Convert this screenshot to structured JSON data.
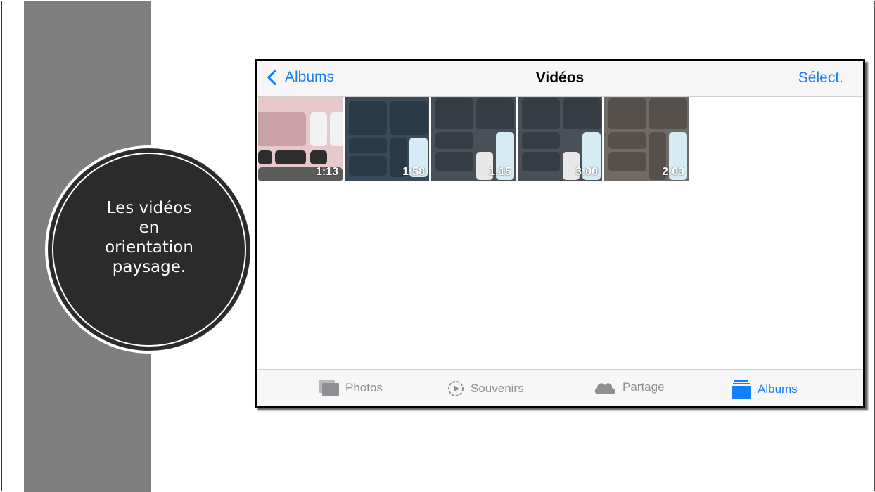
{
  "slide": {
    "caption_lines": [
      "Les vidéos",
      "en",
      "orientation",
      "paysage."
    ]
  },
  "navbar": {
    "back_label": "Albums",
    "title": "Vidéos",
    "select_label": "Sélect."
  },
  "videos": [
    {
      "duration": "1:13"
    },
    {
      "duration": "1:58"
    },
    {
      "duration": "1:15"
    },
    {
      "duration": "3:00"
    },
    {
      "duration": "2:03"
    }
  ],
  "tabbar": {
    "tabs": [
      {
        "label": "Photos",
        "icon": "photos-icon"
      },
      {
        "label": "Souvenirs",
        "icon": "souvenirs-icon"
      },
      {
        "label": "Partage",
        "icon": "cloud-icon"
      },
      {
        "label": "Albums",
        "icon": "albums-icon"
      }
    ],
    "active_index": 3
  },
  "colors": {
    "accent": "#147efb",
    "inactive": "#8e8e93",
    "side_bar": "#7f7f7f",
    "circle": "#2b2b2b"
  }
}
